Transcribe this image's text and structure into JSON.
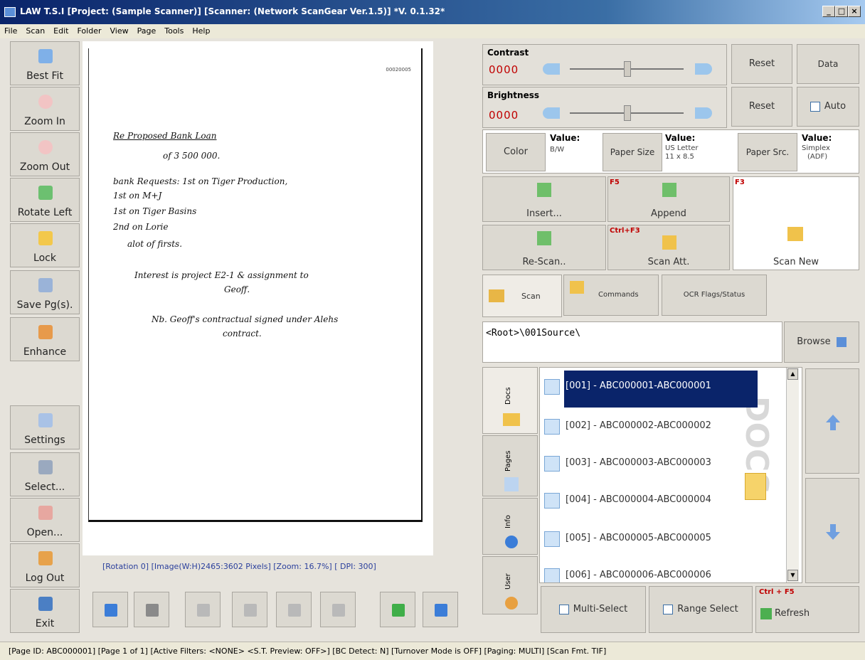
{
  "window": {
    "title": "LAW T.S.I  [Project: (Sample Scanner)]  [Scanner: (Network ScanGear Ver.1.5)]  *V. 0.1.32*",
    "min": "_",
    "max": "□",
    "close": "×"
  },
  "menu": [
    "File",
    "Scan",
    "Edit",
    "Folder",
    "View",
    "Page",
    "Tools",
    "Help"
  ],
  "left_toolbar": [
    {
      "label": "Best Fit",
      "icon": "best-fit-icon"
    },
    {
      "label": "Zoom In",
      "icon": "zoom-in-icon"
    },
    {
      "label": "Zoom Out",
      "icon": "zoom-out-icon"
    },
    {
      "label": "Rotate Left",
      "icon": "rotate-left-icon"
    },
    {
      "label": "Lock",
      "icon": "lock-icon"
    },
    {
      "label": "Save Pg(s).",
      "icon": "save-icon"
    },
    {
      "label": "Enhance",
      "icon": "enhance-icon"
    }
  ],
  "left_toolbar_bottom": [
    {
      "label": "Settings",
      "icon": "settings-icon"
    },
    {
      "label": "Select...",
      "icon": "scanner-icon"
    },
    {
      "label": "Open...",
      "icon": "open-icon"
    },
    {
      "label": "Log Out",
      "icon": "logout-icon"
    },
    {
      "label": "Exit",
      "icon": "exit-icon"
    }
  ],
  "document": {
    "page_number": "00020005",
    "lines": [
      "Re Proposed Bank Loan",
      "of 3 500 000.",
      "bank Requests:  1st on Tiger Production,",
      "1st on M+J",
      "1st on Tiger Basins",
      "2nd on Lorie",
      "alot of firsts.",
      "Interest is project  E2-1 & assignment to",
      "Geoff.",
      "Nb.  Geoff's contractual signed under Alehs",
      "contract."
    ]
  },
  "image_info": "[Rotation 0] [Image(W:H)2465:3602 Pixels] [Zoom: 16.7%] [ DPI: 300]",
  "contrast": {
    "label": "Contrast",
    "value": "0000",
    "reset": "Reset",
    "data": "Data"
  },
  "brightness": {
    "label": "Brightness",
    "value": "0000",
    "reset": "Reset",
    "auto": "Auto"
  },
  "settings_row": {
    "color_btn": "Color",
    "color_value_label": "Value:",
    "color_value": "B/W",
    "paper_size_btn": "Paper Size",
    "paper_size_value_label": "Value:",
    "paper_size_value_1": "US Letter",
    "paper_size_value_2": "11 x 8.5",
    "paper_src_btn": "Paper Src.",
    "paper_src_value_label": "Value:",
    "paper_src_value_1": "Simplex",
    "paper_src_value_2": "(ADF)"
  },
  "scan_actions": {
    "insert": "Insert...",
    "append": "Append",
    "append_key": "F5",
    "rescan": "Re-Scan..",
    "scan_att": "Scan Att.",
    "scan_att_key": "Ctrl+F3",
    "scan_new": "Scan New",
    "scan_new_key": "F3"
  },
  "tabs": [
    "Scan",
    "Commands",
    "OCR Flags/Status"
  ],
  "path": {
    "value": "<Root>\\001Source\\",
    "browse": "Browse"
  },
  "side_tabs": [
    "Docs",
    "Pages",
    "Info",
    "User"
  ],
  "docs_list": [
    "[001] - ABC000001-ABC000001",
    "[002] - ABC000002-ABC000002",
    "[003] - ABC000003-ABC000003",
    "[004] - ABC000004-ABC000004",
    "[005] - ABC000005-ABC000005",
    "[006] - ABC000006-ABC000006"
  ],
  "docs_watermark": "DOCS",
  "bottom_actions": {
    "multi_select": "Multi-Select",
    "range_select": "Range Select",
    "refresh": "Refresh",
    "refresh_key": "Ctrl + F5"
  },
  "status": "[Page ID: ABC000001]  [Page 1 of 1]    [Active Filters: <NONE> <S.T. Preview: OFF>]  [BC Detect: N]  [Turnover Mode is OFF]  [Paging: MULTI]  [Scan Fmt. TIF]",
  "colors": {
    "titlebar": "#0a246a",
    "accent_red": "#c00000",
    "selected": "#0a246a",
    "info_text": "#2a3f9c"
  }
}
